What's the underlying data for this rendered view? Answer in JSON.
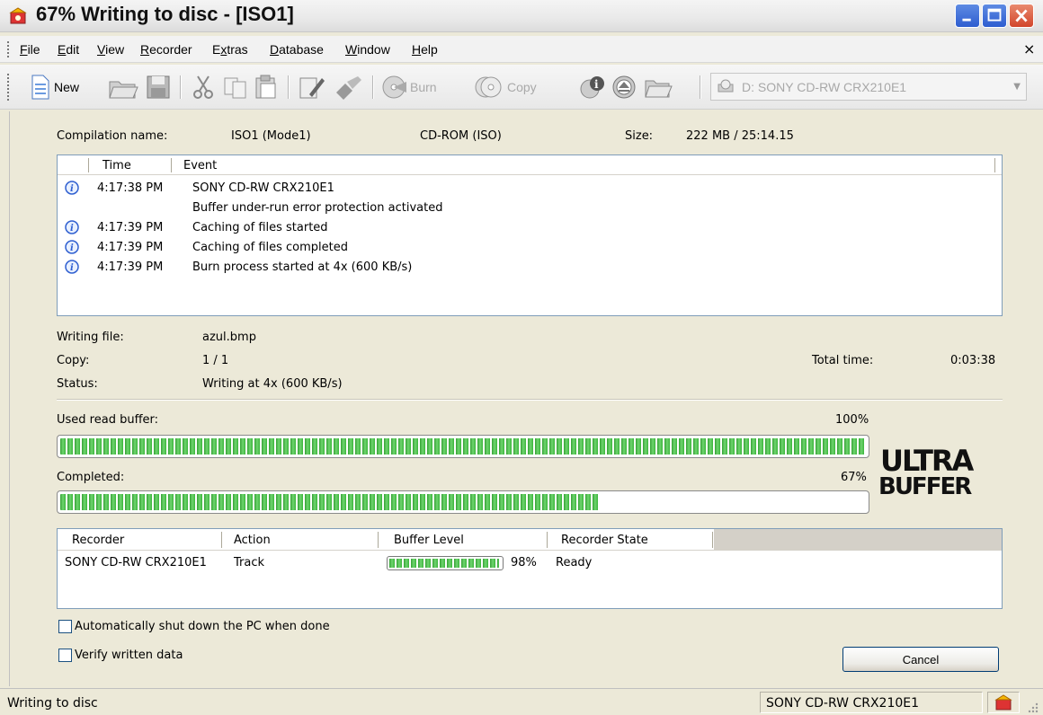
{
  "window": {
    "title": "67% Writing to disc - [ISO1]"
  },
  "menu": {
    "items": [
      "File",
      "Edit",
      "View",
      "Recorder",
      "Extras",
      "Database",
      "Window",
      "Help"
    ],
    "underline": [
      "F",
      "E",
      "V",
      "R",
      "x",
      "D",
      "W",
      "H"
    ]
  },
  "toolbar": {
    "new_label": "New",
    "burn_label": "Burn",
    "copy_label": "Copy",
    "drive": "D: SONY CD-RW  CRX210E1"
  },
  "compilation": {
    "name_label": "Compilation name:",
    "name": "ISO1 (Mode1)",
    "type": "CD-ROM (ISO)",
    "size_label": "Size:",
    "size": "222 MB  /  25:14.15"
  },
  "log": {
    "columns": [
      "Time",
      "Event"
    ],
    "rows": [
      {
        "time": "4:17:38 PM",
        "event": "SONY CD-RW  CRX210E1",
        "icon": "info-icon"
      },
      {
        "time": "",
        "event": "Buffer under-run error protection activated",
        "icon": ""
      },
      {
        "time": "4:17:39 PM",
        "event": "Caching of files started",
        "icon": "info-icon"
      },
      {
        "time": "4:17:39 PM",
        "event": "Caching of files completed",
        "icon": "info-icon"
      },
      {
        "time": "4:17:39 PM",
        "event": "Burn process started at 4x (600 KB/s)",
        "icon": "info-icon"
      }
    ]
  },
  "progress": {
    "writing_file_label": "Writing file:",
    "writing_file": "azul.bmp",
    "copy_label": "Copy:",
    "copy": "1 / 1",
    "status_label": "Status:",
    "status": "Writing at 4x (600 KB/s)",
    "total_time_label": "Total time:",
    "total_time": "0:03:38",
    "read_buffer_label": "Used read buffer:",
    "read_buffer_pct_text": "100%",
    "read_buffer_value": 1.0,
    "completed_label": "Completed:",
    "completed_pct_text": "67%",
    "completed_value": 0.67
  },
  "recorders": {
    "columns": [
      "Recorder",
      "Action",
      "Buffer Level",
      "Recorder State"
    ],
    "rows": [
      {
        "recorder": "SONY CD-RW  CRX210E1",
        "action": "Track",
        "buffer_pct_text": "98%",
        "buffer_value": 0.98,
        "state": "Ready"
      }
    ]
  },
  "options": {
    "shutdown_label": "Automatically shut down the PC when done",
    "shutdown_checked": false,
    "verify_label": "Verify written data",
    "verify_checked": false
  },
  "buttons": {
    "cancel": "Cancel"
  },
  "statusbar": {
    "text": "Writing to disc",
    "recorder": "SONY    CD-RW  CRX210E1"
  },
  "logo_text": "ULTRA BUFFER",
  "colors": {
    "progress_green": "#3cb43c",
    "info_blue": "#2f5fd0",
    "panel_bg": "#ece9d8"
  }
}
